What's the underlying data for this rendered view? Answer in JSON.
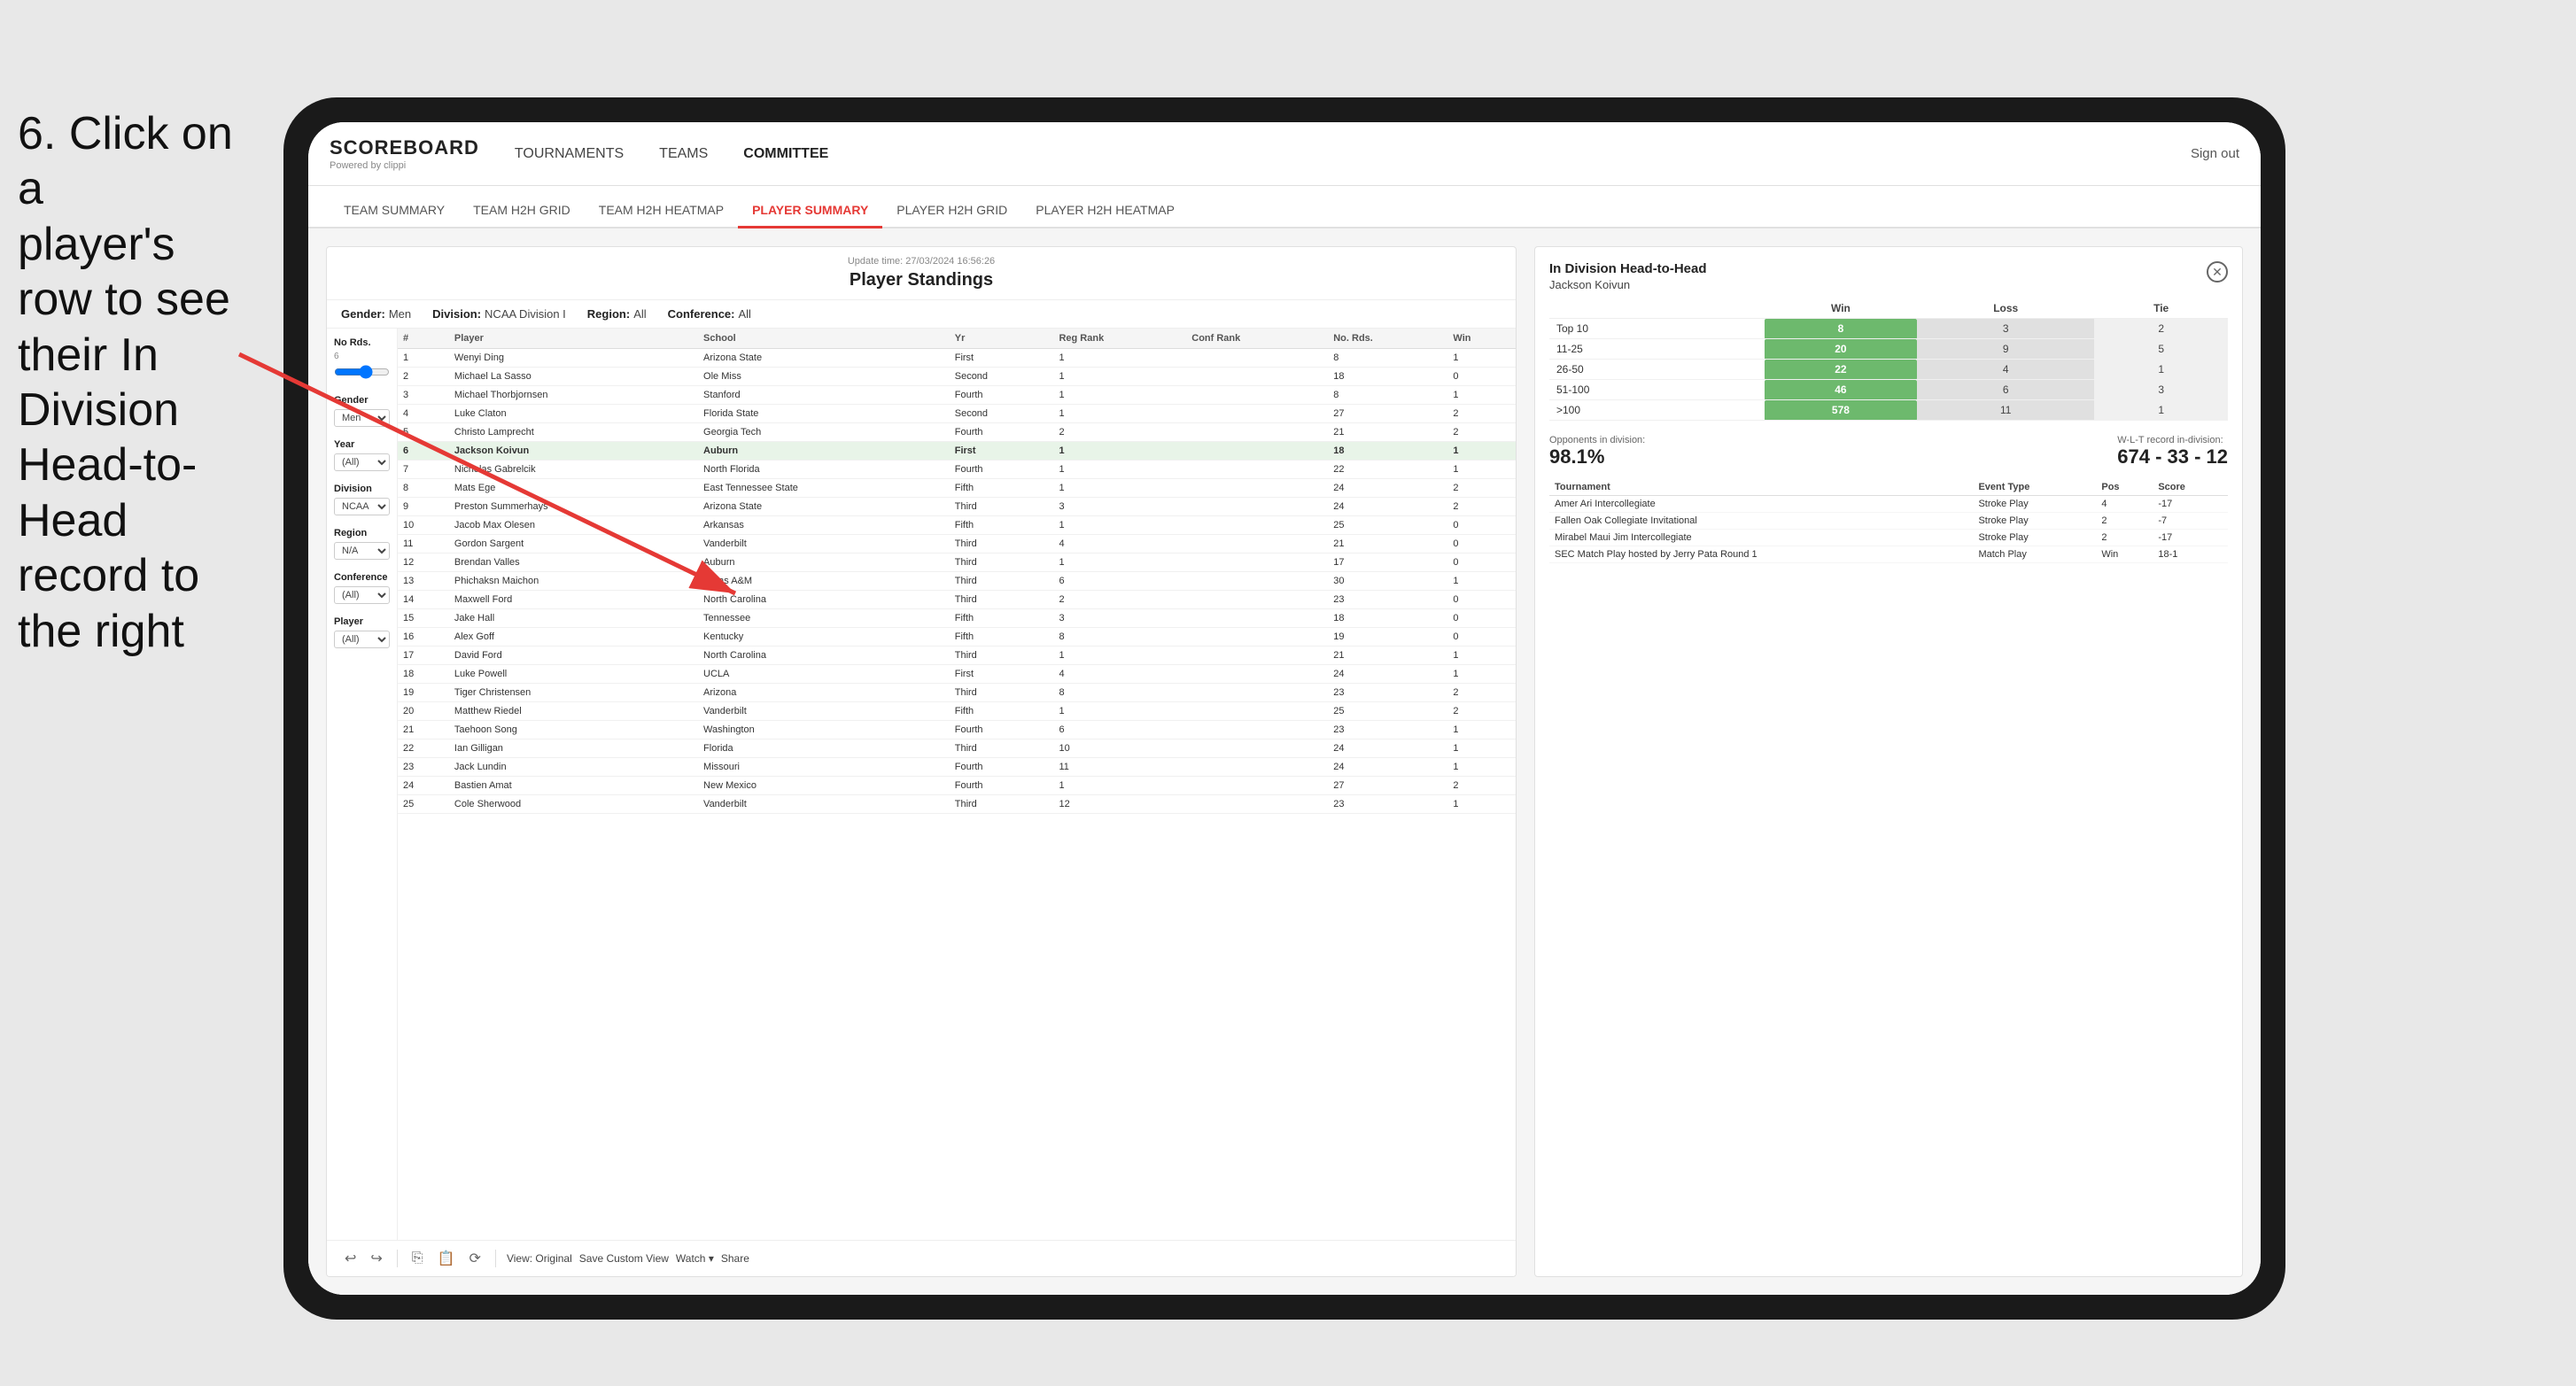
{
  "instruction": {
    "line1": "6. Click on a",
    "line2": "player's row to see",
    "line3": "their In Division",
    "line4": "Head-to-Head",
    "line5": "record to the right"
  },
  "app": {
    "logo_title": "SCOREBOARD",
    "logo_subtitle": "Powered by clippi",
    "sign_out": "Sign out",
    "nav_items": [
      "TOURNAMENTS",
      "TEAMS",
      "COMMITTEE"
    ],
    "sub_nav_items": [
      "TEAM SUMMARY",
      "TEAM H2H GRID",
      "TEAM H2H HEATMAP",
      "PLAYER SUMMARY",
      "PLAYER H2H GRID",
      "PLAYER H2H HEATMAP"
    ],
    "active_sub_nav": "PLAYER SUMMARY"
  },
  "panel": {
    "title": "Player Standings",
    "update_time": "Update time:",
    "update_value": "27/03/2024 16:56:26",
    "gender_label": "Gender:",
    "gender_value": "Men",
    "division_label": "Division:",
    "division_value": "NCAA Division I",
    "region_label": "Region:",
    "region_value": "All",
    "conference_label": "Conference:",
    "conference_value": "All"
  },
  "sidebar": {
    "rounds_title": "No Rds.",
    "rounds_range": "6",
    "gender_title": "Gender",
    "gender_value": "Men",
    "year_title": "Year",
    "year_value": "(All)",
    "division_title": "Division",
    "division_value": "NCAA Division I",
    "region_title": "Region",
    "region_value": "N/A",
    "conference_title": "Conference",
    "conference_value": "(All)",
    "player_title": "Player",
    "player_value": "(All)"
  },
  "table": {
    "headers": [
      "#",
      "Player",
      "School",
      "Yr",
      "Reg Rank",
      "Conf Rank",
      "No. Rds.",
      "Win"
    ],
    "rows": [
      {
        "num": 1,
        "player": "Wenyi Ding",
        "school": "Arizona State",
        "yr": "First",
        "reg": 1,
        "conf": "",
        "rds": 8,
        "win": 1
      },
      {
        "num": 2,
        "player": "Michael La Sasso",
        "school": "Ole Miss",
        "yr": "Second",
        "reg": 1,
        "conf": "",
        "rds": 18,
        "win": 0
      },
      {
        "num": 3,
        "player": "Michael Thorbjornsen",
        "school": "Stanford",
        "yr": "Fourth",
        "reg": 1,
        "conf": "",
        "rds": 8,
        "win": 1
      },
      {
        "num": 4,
        "player": "Luke Claton",
        "school": "Florida State",
        "yr": "Second",
        "reg": 1,
        "conf": "",
        "rds": 27,
        "win": 2
      },
      {
        "num": 5,
        "player": "Christo Lamprecht",
        "school": "Georgia Tech",
        "yr": "Fourth",
        "reg": 2,
        "conf": "",
        "rds": 21,
        "win": 2
      },
      {
        "num": 6,
        "player": "Jackson Koivun",
        "school": "Auburn",
        "yr": "First",
        "reg": 1,
        "conf": "",
        "rds": 18,
        "win": 1,
        "selected": true
      },
      {
        "num": 7,
        "player": "Nicholas Gabrelcik",
        "school": "North Florida",
        "yr": "Fourth",
        "reg": 1,
        "conf": "",
        "rds": 22,
        "win": 1
      },
      {
        "num": 8,
        "player": "Mats Ege",
        "school": "East Tennessee State",
        "yr": "Fifth",
        "reg": 1,
        "conf": "",
        "rds": 24,
        "win": 2
      },
      {
        "num": 9,
        "player": "Preston Summerhays",
        "school": "Arizona State",
        "yr": "Third",
        "reg": 3,
        "conf": "",
        "rds": 24,
        "win": 2
      },
      {
        "num": 10,
        "player": "Jacob Max Olesen",
        "school": "Arkansas",
        "yr": "Fifth",
        "reg": 1,
        "conf": "",
        "rds": 25,
        "win": 0
      },
      {
        "num": 11,
        "player": "Gordon Sargent",
        "school": "Vanderbilt",
        "yr": "Third",
        "reg": 4,
        "conf": "",
        "rds": 21,
        "win": 0
      },
      {
        "num": 12,
        "player": "Brendan Valles",
        "school": "Auburn",
        "yr": "Third",
        "reg": 1,
        "conf": "",
        "rds": 17,
        "win": 0
      },
      {
        "num": 13,
        "player": "Phichaksn Maichon",
        "school": "Texas A&M",
        "yr": "Third",
        "reg": 6,
        "conf": "",
        "rds": 30,
        "win": 1
      },
      {
        "num": 14,
        "player": "Maxwell Ford",
        "school": "North Carolina",
        "yr": "Third",
        "reg": 2,
        "conf": "",
        "rds": 23,
        "win": 0
      },
      {
        "num": 15,
        "player": "Jake Hall",
        "school": "Tennessee",
        "yr": "Fifth",
        "reg": 3,
        "conf": "",
        "rds": 18,
        "win": 0
      },
      {
        "num": 16,
        "player": "Alex Goff",
        "school": "Kentucky",
        "yr": "Fifth",
        "reg": 8,
        "conf": "",
        "rds": 19,
        "win": 0
      },
      {
        "num": 17,
        "player": "David Ford",
        "school": "North Carolina",
        "yr": "Third",
        "reg": 1,
        "conf": "",
        "rds": 21,
        "win": 1
      },
      {
        "num": 18,
        "player": "Luke Powell",
        "school": "UCLA",
        "yr": "First",
        "reg": 4,
        "conf": "",
        "rds": 24,
        "win": 1
      },
      {
        "num": 19,
        "player": "Tiger Christensen",
        "school": "Arizona",
        "yr": "Third",
        "reg": 8,
        "conf": "",
        "rds": 23,
        "win": 2
      },
      {
        "num": 20,
        "player": "Matthew Riedel",
        "school": "Vanderbilt",
        "yr": "Fifth",
        "reg": 1,
        "conf": "",
        "rds": 25,
        "win": 2
      },
      {
        "num": 21,
        "player": "Taehoon Song",
        "school": "Washington",
        "yr": "Fourth",
        "reg": 6,
        "conf": "",
        "rds": 23,
        "win": 1
      },
      {
        "num": 22,
        "player": "Ian Gilligan",
        "school": "Florida",
        "yr": "Third",
        "reg": 10,
        "conf": "",
        "rds": 24,
        "win": 1
      },
      {
        "num": 23,
        "player": "Jack Lundin",
        "school": "Missouri",
        "yr": "Fourth",
        "reg": 11,
        "conf": "",
        "rds": 24,
        "win": 1
      },
      {
        "num": 24,
        "player": "Bastien Amat",
        "school": "New Mexico",
        "yr": "Fourth",
        "reg": 1,
        "conf": "",
        "rds": 27,
        "win": 2
      },
      {
        "num": 25,
        "player": "Cole Sherwood",
        "school": "Vanderbilt",
        "yr": "Third",
        "reg": 12,
        "conf": "",
        "rds": 23,
        "win": 1
      }
    ]
  },
  "h2h": {
    "title": "In Division Head-to-Head",
    "player": "Jackson Koivun",
    "table_headers": [
      "",
      "Win",
      "Loss",
      "Tie"
    ],
    "rows": [
      {
        "label": "Top 10",
        "win": 8,
        "loss": 3,
        "tie": 2
      },
      {
        "label": "11-25",
        "win": 20,
        "loss": 9,
        "tie": 5
      },
      {
        "label": "26-50",
        "win": 22,
        "loss": 4,
        "tie": 1
      },
      {
        "label": "51-100",
        "win": 46,
        "loss": 6,
        "tie": 3
      },
      {
        "label": ">100",
        "win": 578,
        "loss": 11,
        "tie": 1
      }
    ],
    "opponents_label": "Opponents in division:",
    "wlt_label": "W-L-T record in-division:",
    "opponents_pct": "98.1%",
    "wlt_record": "674 - 33 - 12",
    "tournament_headers": [
      "Tournament",
      "Event Type",
      "Pos",
      "Score"
    ],
    "tournaments": [
      {
        "name": "Amer Ari Intercollegiate",
        "type": "Stroke Play",
        "pos": 4,
        "score": "-17"
      },
      {
        "name": "Fallen Oak Collegiate Invitational",
        "type": "Stroke Play",
        "pos": 2,
        "score": "-7"
      },
      {
        "name": "Mirabel Maui Jim Intercollegiate",
        "type": "Stroke Play",
        "pos": 2,
        "score": "-17"
      },
      {
        "name": "SEC Match Play hosted by Jerry Pata Round 1",
        "type": "Match Play",
        "pos": "Win",
        "score": "18-1"
      }
    ]
  },
  "toolbar": {
    "view_original": "View: Original",
    "save_custom": "Save Custom View",
    "watch": "Watch ▾",
    "share": "Share"
  }
}
